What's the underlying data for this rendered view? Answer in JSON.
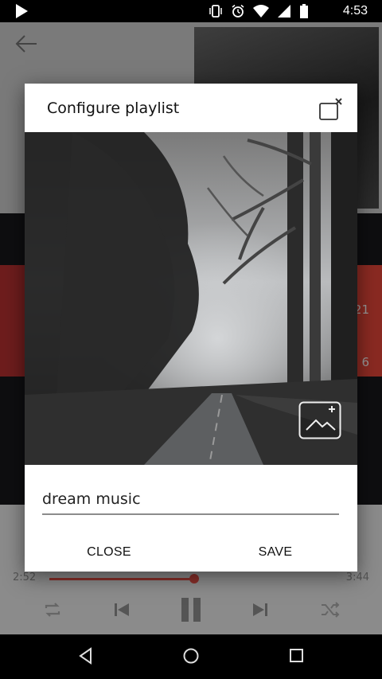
{
  "status_bar": {
    "time": "4:53",
    "icons": [
      "play-icon",
      "vibrate-icon",
      "alarm-icon",
      "wifi-icon",
      "signal-icon",
      "battery-icon"
    ]
  },
  "background_app": {
    "header_icon": "arrow-left-icon",
    "partial_text_1": "21",
    "partial_text_2": "6",
    "time_elapsed": "2:52",
    "time_total": "3:44",
    "playback_progress": 0.41,
    "controls": [
      "repeat-icon",
      "skip-previous-icon",
      "pause-icon",
      "skip-next-icon",
      "shuffle-icon"
    ]
  },
  "dialog": {
    "title": "Configure playlist",
    "playlist_name": "dream music",
    "close_label": "CLOSE",
    "save_label": "SAVE",
    "corner_icon": "remove-image-icon",
    "change_image_icon": "add-photo-icon"
  },
  "nav_bar": {
    "icons": [
      "nav-back-icon",
      "nav-home-icon",
      "nav-recents-icon"
    ]
  },
  "colors": {
    "accent": "#8a2f2a",
    "dialog_bg": "#ffffff",
    "dim_bg": "#777777"
  }
}
